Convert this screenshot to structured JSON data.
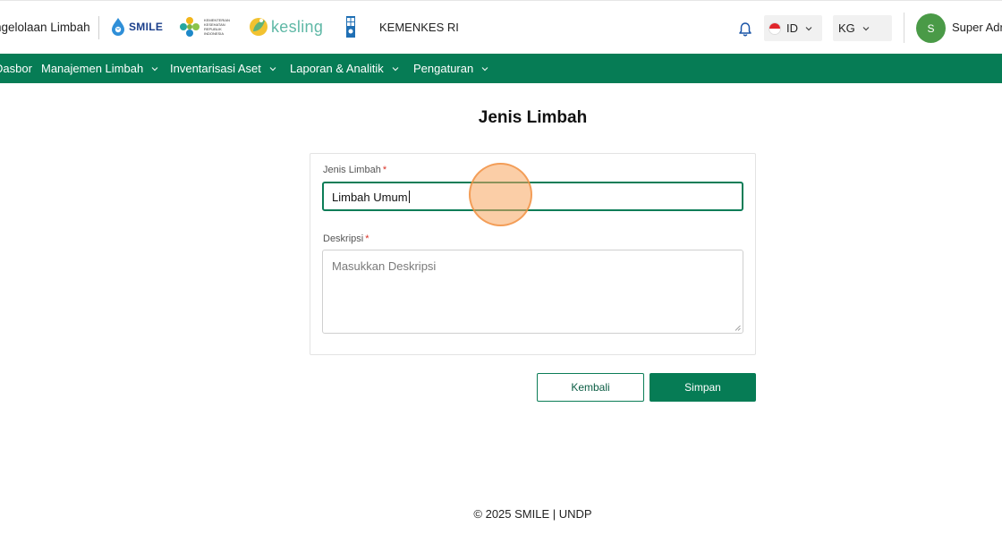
{
  "header": {
    "app_title": "ngelolaan Limbah",
    "smile_logo_text": "SMILE",
    "kemenkes_logo_text": "KEMENTERIAN KESEHATAN REPUBLIK INDONESIA",
    "kesling_logo_text": "kesling",
    "company": "KEMENKES RI",
    "language": "ID",
    "unit": "KG",
    "avatar_initial": "S",
    "user_name": "Super Adr"
  },
  "nav": {
    "items": [
      {
        "label": "Dasbor",
        "has_dropdown": false
      },
      {
        "label": "Manajemen Limbah",
        "has_dropdown": true
      },
      {
        "label": "Inventarisasi Aset",
        "has_dropdown": true
      },
      {
        "label": "Laporan & Analitik",
        "has_dropdown": true
      },
      {
        "label": "Pengaturan",
        "has_dropdown": true
      }
    ]
  },
  "page": {
    "title": "Jenis Limbah"
  },
  "form": {
    "name_label": "Jenis Limbah",
    "name_value": "Limbah Umum",
    "description_label": "Deskripsi",
    "description_value": "",
    "description_placeholder": "Masukkan Deskripsi",
    "required_mark": "*"
  },
  "actions": {
    "back_label": "Kembali",
    "save_label": "Simpan"
  },
  "footer": {
    "text": "© 2025 SMILE | UNDP"
  },
  "colors": {
    "brand_green": "#067c55",
    "required_red": "#d93025",
    "avatar_green": "#4a9a47"
  },
  "icons": [
    "bell-icon",
    "chevron-down-icon",
    "indonesia-flag-icon",
    "smile-drop-icon",
    "kemenkes-logo-icon",
    "kesling-logo-icon",
    "undp-logo-icon"
  ]
}
